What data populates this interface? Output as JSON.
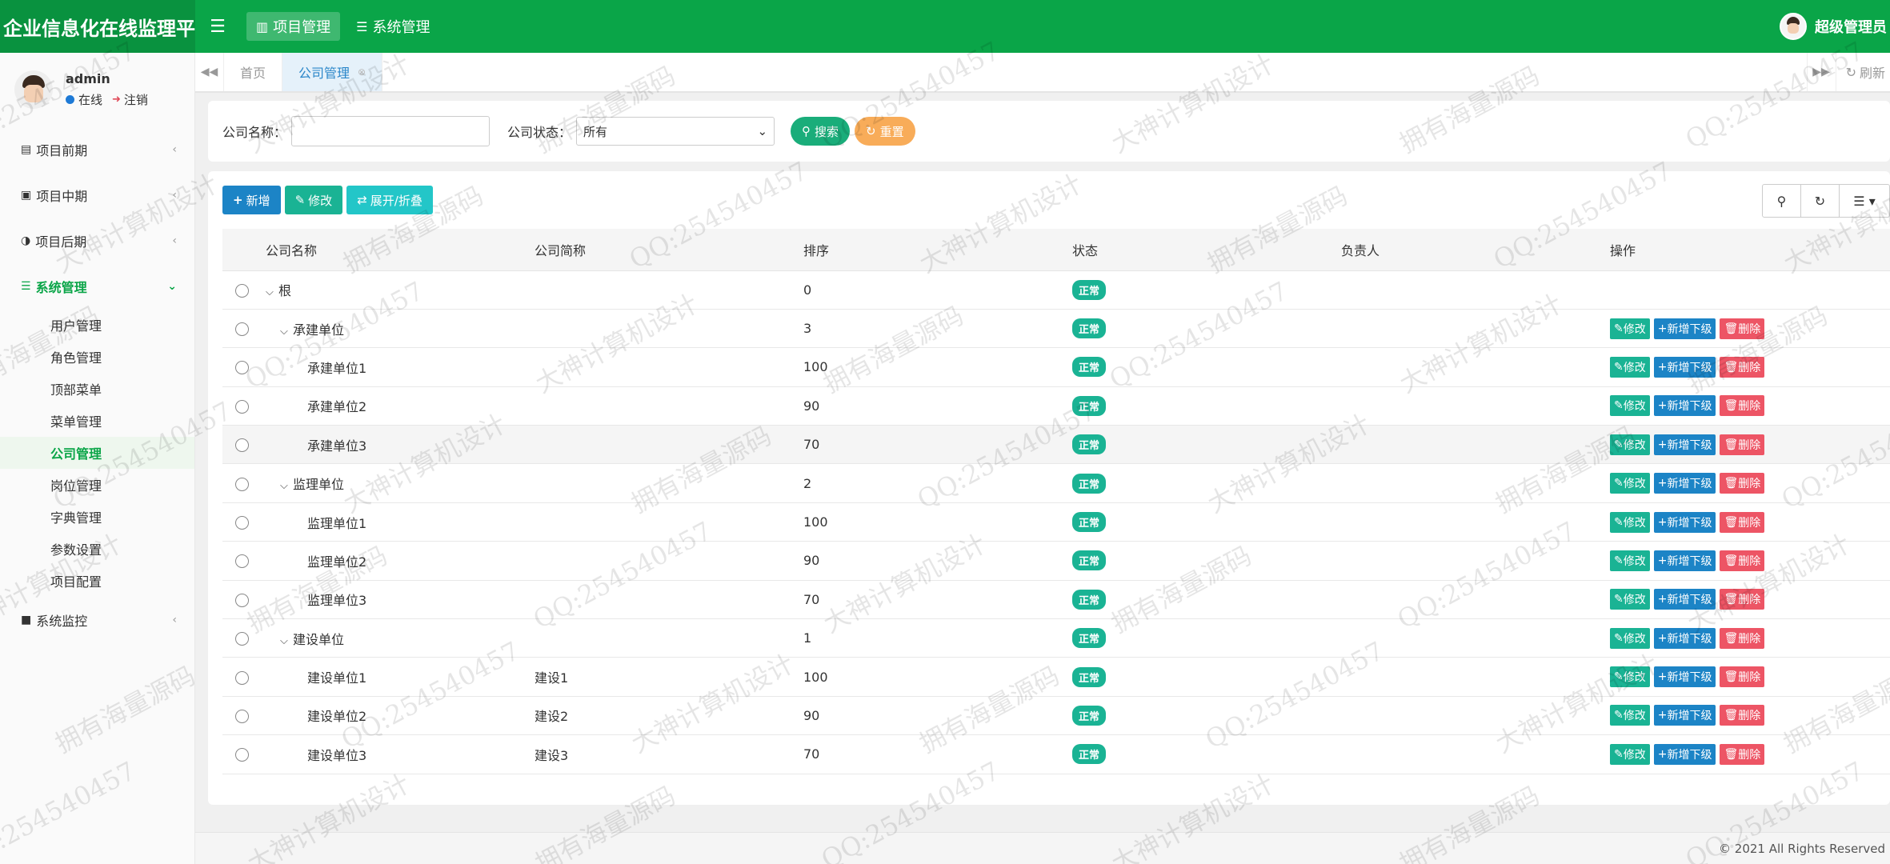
{
  "app": {
    "title": "企业信息化在线监理平台"
  },
  "topnav": [
    {
      "label": "项目管理",
      "icon": "chart-icon",
      "active": true
    },
    {
      "label": "系统管理",
      "icon": "list-icon",
      "active": false
    }
  ],
  "topuser": {
    "name": "超级管理员"
  },
  "sidebar": {
    "user": {
      "name": "admin",
      "status": "在线",
      "logout": "注销"
    },
    "groups": [
      {
        "label": "项目前期"
      },
      {
        "label": "项目中期"
      },
      {
        "label": "项目后期"
      },
      {
        "label": "系统管理"
      },
      {
        "label": "系统监控"
      }
    ],
    "subitems": [
      "用户管理",
      "角色管理",
      "顶部菜单",
      "菜单管理",
      "公司管理",
      "岗位管理",
      "字典管理",
      "参数设置",
      "项目配置"
    ]
  },
  "tabs": {
    "home": "首页",
    "current": "公司管理",
    "refresh": "刷新"
  },
  "search": {
    "name_label": "公司名称：",
    "name_value": "",
    "status_label": "公司状态：",
    "status_value": "所有",
    "search_btn": "搜索",
    "reset_btn": "重置"
  },
  "toolbar": {
    "add": "新增",
    "edit": "修改",
    "toggle": "展开/折叠"
  },
  "table": {
    "headers": [
      "公司名称",
      "公司简称",
      "排序",
      "状态",
      "负责人",
      "操作"
    ],
    "ops": {
      "edit": "修改",
      "add": "新增下级",
      "del": "删除"
    },
    "rows": [
      {
        "name": "根",
        "short": "",
        "sort": "0",
        "status": "正常",
        "owner": ""
      },
      {
        "name": "承建单位",
        "short": "",
        "sort": "3",
        "status": "正常",
        "owner": ""
      },
      {
        "name": "承建单位1",
        "short": "",
        "sort": "100",
        "status": "正常",
        "owner": ""
      },
      {
        "name": "承建单位2",
        "short": "",
        "sort": "90",
        "status": "正常",
        "owner": ""
      },
      {
        "name": "承建单位3",
        "short": "",
        "sort": "70",
        "status": "正常",
        "owner": ""
      },
      {
        "name": "监理单位",
        "short": "",
        "sort": "2",
        "status": "正常",
        "owner": ""
      },
      {
        "name": "监理单位1",
        "short": "",
        "sort": "100",
        "status": "正常",
        "owner": ""
      },
      {
        "name": "监理单位2",
        "short": "",
        "sort": "90",
        "status": "正常",
        "owner": ""
      },
      {
        "name": "监理单位3",
        "short": "",
        "sort": "70",
        "status": "正常",
        "owner": ""
      },
      {
        "name": "建设单位",
        "short": "",
        "sort": "1",
        "status": "正常",
        "owner": ""
      },
      {
        "name": "建设单位1",
        "short": "建设1",
        "sort": "100",
        "status": "正常",
        "owner": ""
      },
      {
        "name": "建设单位2",
        "short": "建设2",
        "sort": "90",
        "status": "正常",
        "owner": ""
      },
      {
        "name": "建设单位3",
        "short": "建设3",
        "sort": "70",
        "status": "正常",
        "owner": ""
      }
    ]
  },
  "footer": {
    "copyright": "© 2021 All Rights Reserved"
  },
  "watermarks": [
    "QQ:254540457",
    "大神计算机设计",
    "拥有海量源码"
  ],
  "colors": {
    "primary": "#0aa548",
    "blue": "#1c84c6",
    "teal": "#1ab394",
    "red": "#ed5565",
    "orange": "#f8ac59"
  }
}
